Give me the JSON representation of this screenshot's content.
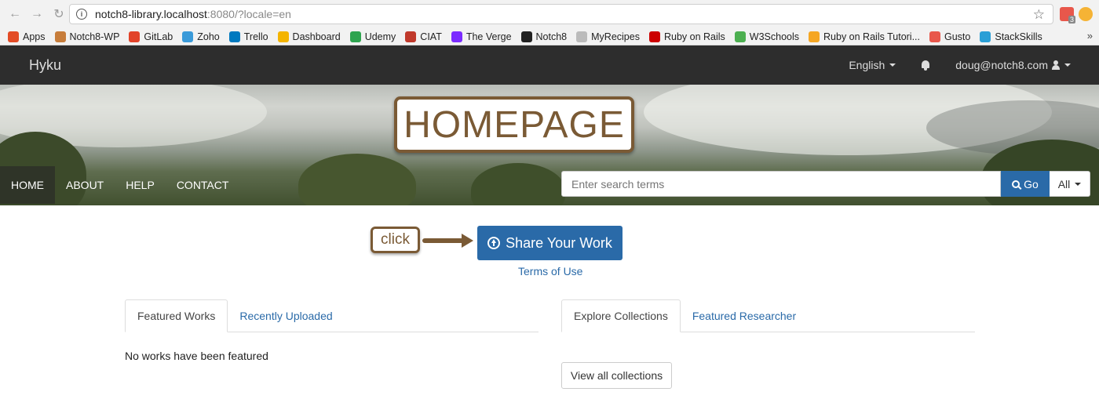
{
  "browser": {
    "url_host": "notch8-library.localhost",
    "url_rest": ":8080/?locale=en",
    "bookmarks": [
      {
        "label": "Apps",
        "color": "#e34c26"
      },
      {
        "label": "Notch8-WP",
        "color": "#c77d3b"
      },
      {
        "label": "GitLab",
        "color": "#e24329"
      },
      {
        "label": "Zoho",
        "color": "#3a9ad9"
      },
      {
        "label": "Trello",
        "color": "#0079bf"
      },
      {
        "label": "Dashboard",
        "color": "#f4b400"
      },
      {
        "label": "Udemy",
        "color": "#2ea44f"
      },
      {
        "label": "CIAT",
        "color": "#c0392b"
      },
      {
        "label": "The Verge",
        "color": "#7b2bff"
      },
      {
        "label": "Notch8",
        "color": "#222222"
      },
      {
        "label": "MyRecipes",
        "color": "#bbbbbb"
      },
      {
        "label": "Ruby on Rails",
        "color": "#cc0000"
      },
      {
        "label": "W3Schools",
        "color": "#4caf50"
      },
      {
        "label": "Ruby on Rails Tutori...",
        "color": "#f5a623"
      },
      {
        "label": "Gusto",
        "color": "#e8574b"
      },
      {
        "label": "StackSkills",
        "color": "#2a9fd6"
      }
    ],
    "more": "»"
  },
  "navbar": {
    "brand": "Hyku",
    "language": "English",
    "user": "doug@notch8.com"
  },
  "banner": {
    "annotation": "HOMEPAGE",
    "menu": [
      "HOME",
      "ABOUT",
      "HELP",
      "CONTACT"
    ],
    "search_placeholder": "Enter search terms",
    "go_label": "Go",
    "scope_label": "All"
  },
  "main": {
    "click_annotation": "click",
    "share_label": "Share Your Work",
    "terms_label": "Terms of Use",
    "left_tabs": [
      "Featured Works",
      "Recently Uploaded"
    ],
    "right_tabs": [
      "Explore Collections",
      "Featured Researcher"
    ],
    "no_works": "No works have been featured",
    "view_all": "View all collections"
  },
  "colors": {
    "primary": "#2a6aa8",
    "navbar": "#2d2d2d",
    "annotation": "#7a5a35"
  }
}
